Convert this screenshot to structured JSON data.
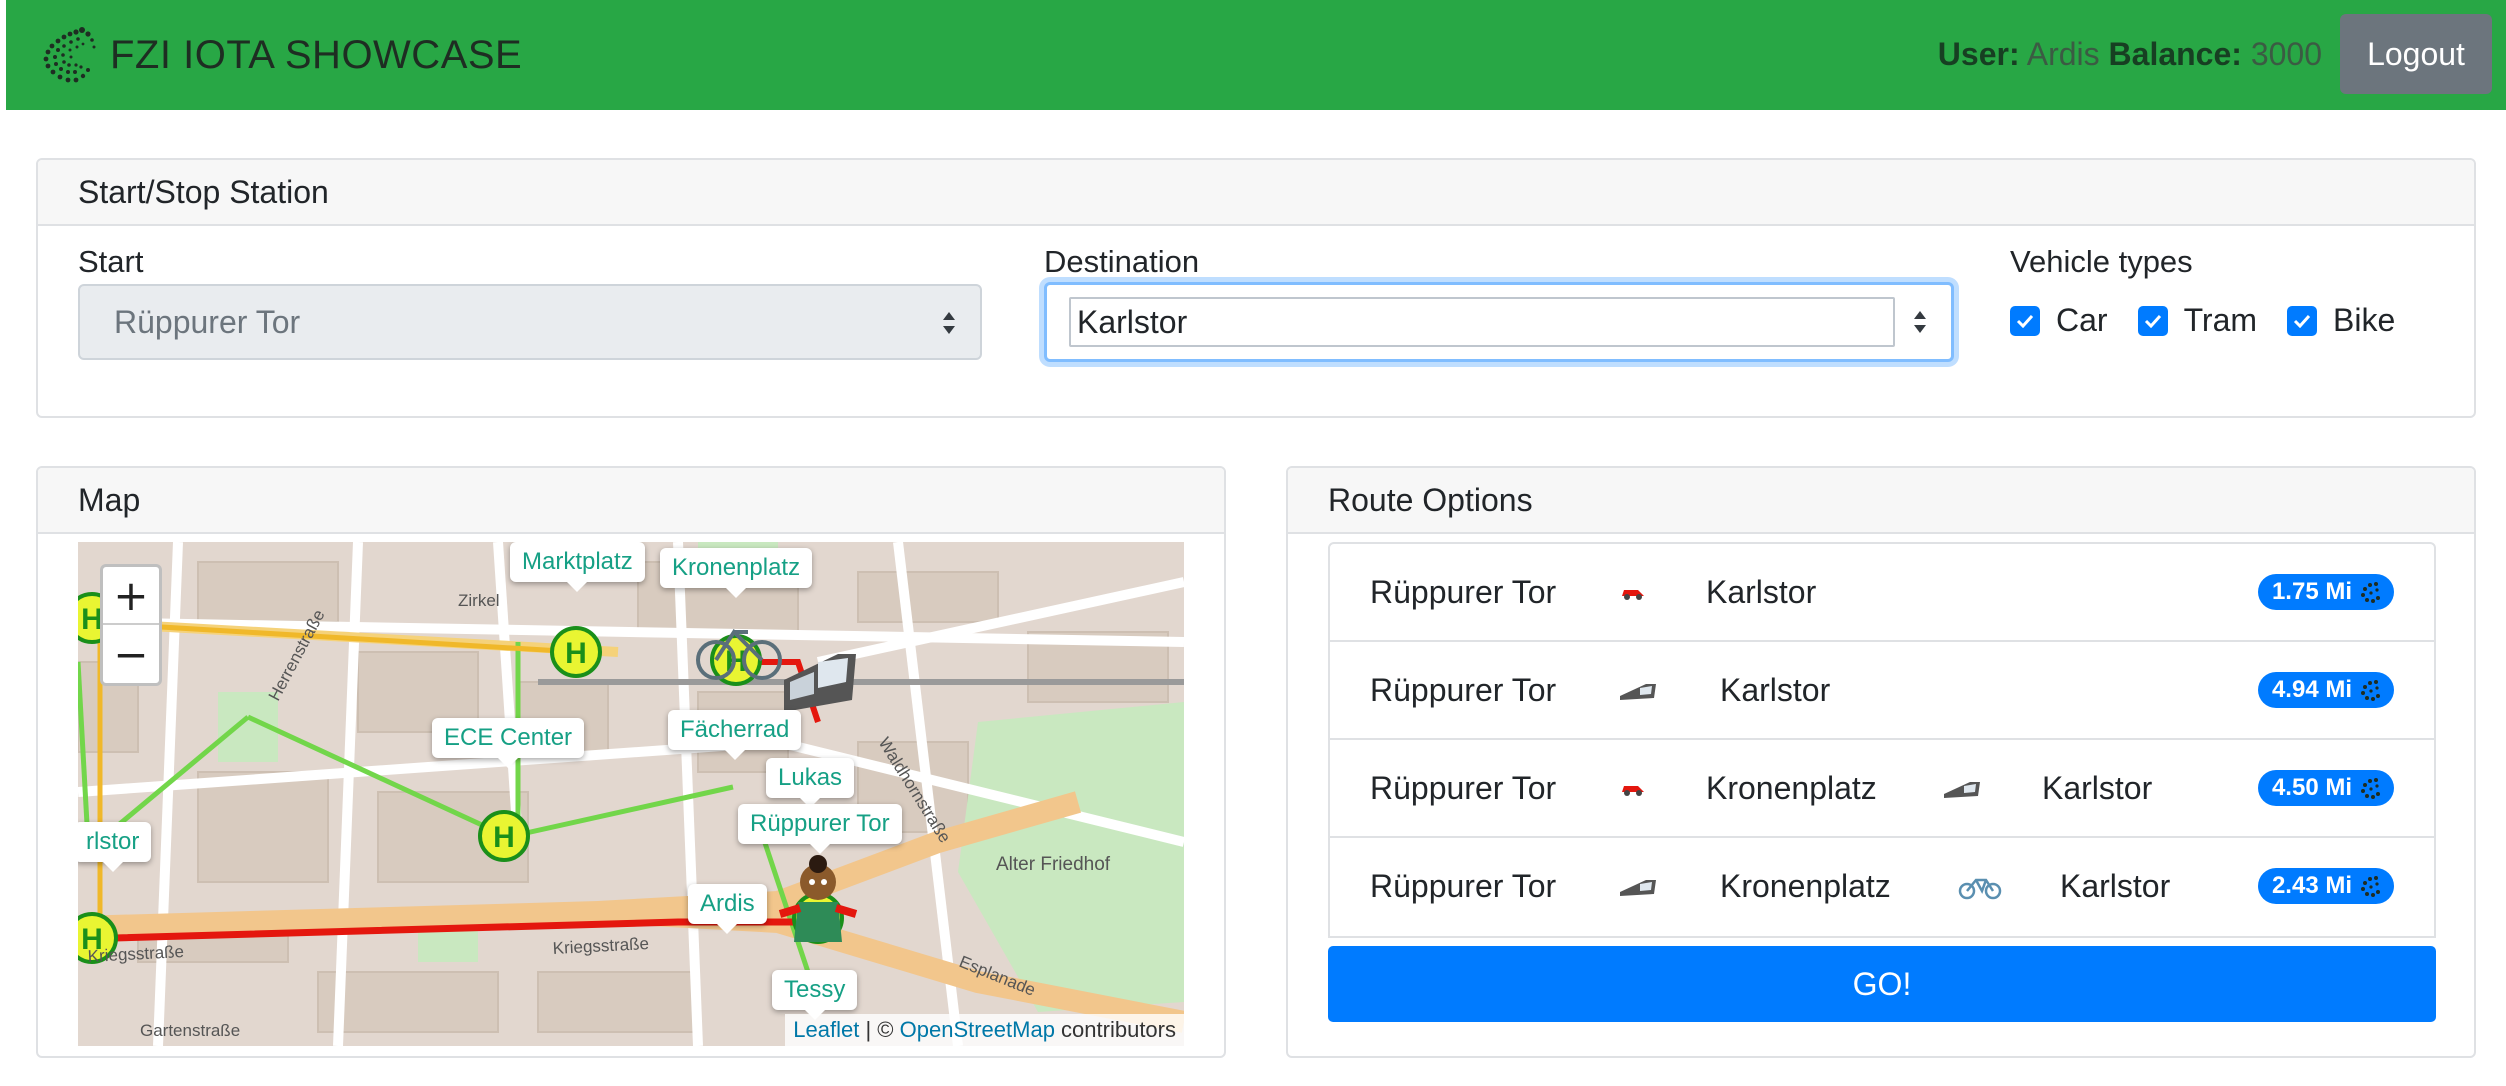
{
  "navbar": {
    "brand": "FZI IOTA SHOWCASE",
    "user_label": "User:",
    "user_name": "Ardis",
    "balance_label": "Balance:",
    "balance_value": "3000",
    "logout_label": "Logout"
  },
  "station": {
    "header": "Start/Stop Station",
    "start_label": "Start",
    "start_value": "Rüppurer Tor",
    "destination_label": "Destination",
    "destination_value": "Karlstor",
    "vehicle_label": "Vehicle types",
    "vehicles": [
      "Car",
      "Tram",
      "Bike"
    ]
  },
  "map": {
    "header": "Map",
    "zoom_in": "+",
    "zoom_out": "−",
    "labels": {
      "marktplatz": "Marktplatz",
      "kronenplatz": "Kronenplatz",
      "ece": "ECE Center",
      "faecherrad": "Fächerrad",
      "lukas": "Lukas",
      "rueppurer": "Rüppurer Tor",
      "ardis": "Ardis",
      "tessy": "Tessy",
      "karlstor": "rlstor"
    },
    "streets": {
      "zirkel": "Zirkel",
      "herrenstrasse": "Herrenstraße",
      "kriegsstrasse": "Kriegsstraße",
      "kriegsstrasse2": "Kriegsstraße",
      "waldhornstrasse": "Waldhornstraße",
      "alter_friedhof": "Alter Friedhof",
      "esplanade": "Esplanade",
      "gartenstrasse": "Gartenstraße"
    },
    "attribution_leaflet": "Leaflet",
    "attribution_sep": " | © ",
    "attribution_osm": "OpenStreetMap",
    "attribution_tail": " contributors"
  },
  "routes": {
    "header": "Route Options",
    "items": [
      {
        "from": "Rüppurer Tor",
        "mid": "",
        "to": "Karlstor",
        "price": "1.75 Mi",
        "v1": "car",
        "v2": ""
      },
      {
        "from": "Rüppurer Tor",
        "mid": "",
        "to": "Karlstor",
        "price": "4.94 Mi",
        "v1": "tram",
        "v2": ""
      },
      {
        "from": "Rüppurer Tor",
        "mid": "Kronenplatz",
        "to": "Karlstor",
        "price": "4.50 Mi",
        "v1": "car",
        "v2": "tram"
      },
      {
        "from": "Rüppurer Tor",
        "mid": "Kronenplatz",
        "to": "Karlstor",
        "price": "2.43 Mi",
        "v1": "tram",
        "v2": "bike"
      }
    ],
    "go_label": "GO!"
  },
  "colors": {
    "navbar": "#28a745",
    "primary": "#007bff",
    "secondary": "#6c757d",
    "station_green": "#c8f21c",
    "route_red": "#e4170e"
  }
}
